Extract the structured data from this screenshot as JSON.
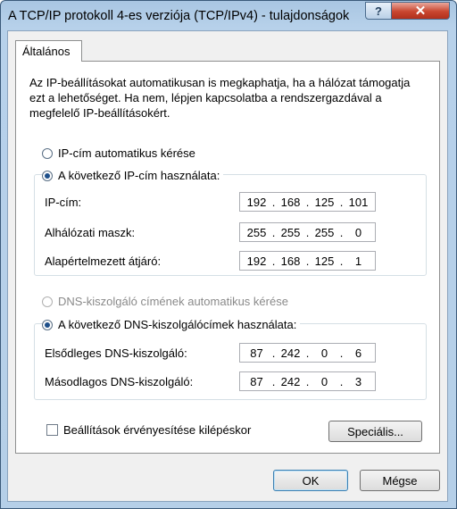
{
  "window": {
    "title": "A TCP/IP protokoll 4-es verziója (TCP/IPv4) - tulajdonságok",
    "help_glyph": "?",
    "close_glyph": "✕"
  },
  "tab": {
    "label": "Általános"
  },
  "intro_text": "Az IP-beállításokat automatikusan is megkaphatja, ha a hálózat támogatja ezt a lehetőséget. Ha nem, lépjen kapcsolatba a rendszergazdával a megfelelő IP-beállításokért.",
  "ip_section": {
    "auto_label": "IP-cím automatikus kérése",
    "auto_selected": false,
    "manual_label": "A következő IP-cím használata:",
    "manual_selected": true,
    "fields": [
      {
        "label": "IP-cím:",
        "octets": [
          "192",
          "168",
          "125",
          "101"
        ]
      },
      {
        "label": "Alhálózati maszk:",
        "octets": [
          "255",
          "255",
          "255",
          "0"
        ]
      },
      {
        "label": "Alapértelmezett átjáró:",
        "octets": [
          "192",
          "168",
          "125",
          "1"
        ]
      }
    ]
  },
  "dns_section": {
    "auto_label": "DNS-kiszolgáló címének automatikus kérése",
    "auto_selected": false,
    "auto_disabled": true,
    "manual_label": "A következő DNS-kiszolgálócímek használata:",
    "manual_selected": true,
    "fields": [
      {
        "label": "Elsődleges DNS-kiszolgáló:",
        "octets": [
          "87",
          "242",
          "0",
          "6"
        ]
      },
      {
        "label": "Másodlagos DNS-kiszolgáló:",
        "octets": [
          "87",
          "242",
          "0",
          "3"
        ]
      }
    ]
  },
  "validate_on_exit": {
    "label": "Beállítások érvényesítése kilépéskor",
    "checked": false
  },
  "buttons": {
    "advanced": "Speciális...",
    "ok": "OK",
    "cancel": "Mégse"
  },
  "colors": {
    "title_bar": "#b7d1ea",
    "close_button": "#c9462f",
    "radio_selected": "#1e4f8a"
  }
}
